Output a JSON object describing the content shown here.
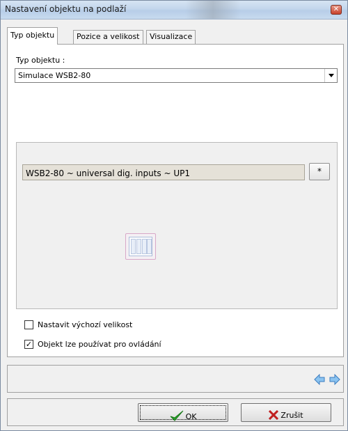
{
  "window": {
    "title": "Nastavení objektu na podlaží"
  },
  "tabs": [
    {
      "label": "Typ objektu"
    },
    {
      "label": "Pozice a velikost"
    },
    {
      "label": "Visualizace"
    }
  ],
  "object_type": {
    "label": "Typ objektu :",
    "selected": "Simulace WSB2-80"
  },
  "object": {
    "name": "WSB2-80 ~ universal dig. inputs ~ UP1",
    "edit_label": "*",
    "icon": "wsb-module-icon"
  },
  "options": [
    {
      "label": "Nastavit výchozí velikost",
      "checked": false
    },
    {
      "label": "Objekt lze používat pro ovládání",
      "checked": true
    }
  ],
  "navigation": {
    "prev_icon": "arrow-left-icon",
    "next_icon": "arrow-right-icon"
  },
  "buttons": {
    "ok_label": "OK",
    "cancel_label": "Zrušit"
  },
  "colors": {
    "arrow": "#5aa0e0",
    "ok_check": "#2aa02a",
    "cancel_x": "#c02020"
  }
}
